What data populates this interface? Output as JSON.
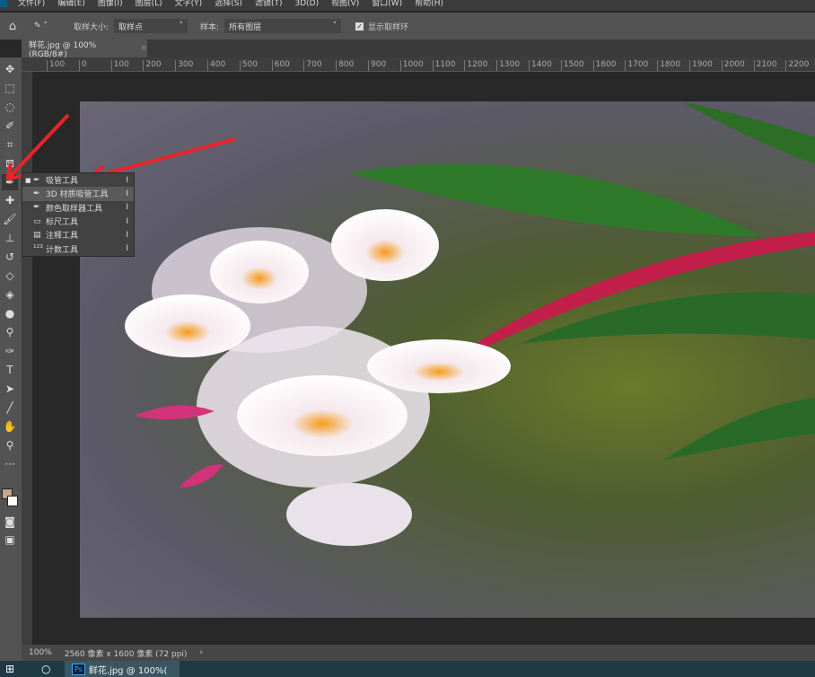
{
  "menubar": {
    "items": [
      "文件(F)",
      "编辑(E)",
      "图像(I)",
      "图层(L)",
      "文字(Y)",
      "选择(S)",
      "滤镜(T)",
      "3D(D)",
      "视图(V)",
      "窗口(W)",
      "帮助(H)"
    ]
  },
  "options": {
    "sample_size_label": "取样大小:",
    "sample_size_value": "取样点",
    "sample_label": "样本:",
    "sample_value": "所有图层",
    "show_ring_label": "显示取样环",
    "show_ring_checked": true
  },
  "document_tab": {
    "title": "鲜花.jpg @ 100%(RGB/8#)",
    "close": "×"
  },
  "ruler": {
    "labels": [
      "100",
      "0",
      "100",
      "200",
      "300",
      "400",
      "500",
      "600",
      "700",
      "800",
      "900",
      "1000",
      "1100",
      "1200",
      "1300",
      "1400",
      "1500",
      "1600",
      "1700",
      "1800",
      "1900",
      "2000",
      "2100",
      "2200"
    ]
  },
  "flyout": {
    "items": [
      {
        "label": "吸管工具",
        "shortcut": "I",
        "icon": "eyedropper-icon",
        "selected": true
      },
      {
        "label": "3D 材质吸管工具",
        "shortcut": "I",
        "icon": "3d-eyedropper-icon"
      },
      {
        "label": "颜色取样器工具",
        "shortcut": "I",
        "icon": "color-sampler-icon"
      },
      {
        "label": "标尺工具",
        "shortcut": "I",
        "icon": "ruler-icon"
      },
      {
        "label": "注释工具",
        "shortcut": "I",
        "icon": "note-icon"
      },
      {
        "label": "计数工具",
        "shortcut": "I",
        "icon": "count-icon"
      }
    ]
  },
  "status": {
    "zoom": "100%",
    "info": "2560 像素 x 1600 像素 (72 ppi)",
    "arrow": "›"
  },
  "taskbar": {
    "app_label": "鲜花.jpg @ 100%(",
    "app_icon": "Ps"
  },
  "colors": {
    "foreground": "#c8a58a",
    "background": "#ffffff",
    "arrow": "#e8242a"
  }
}
